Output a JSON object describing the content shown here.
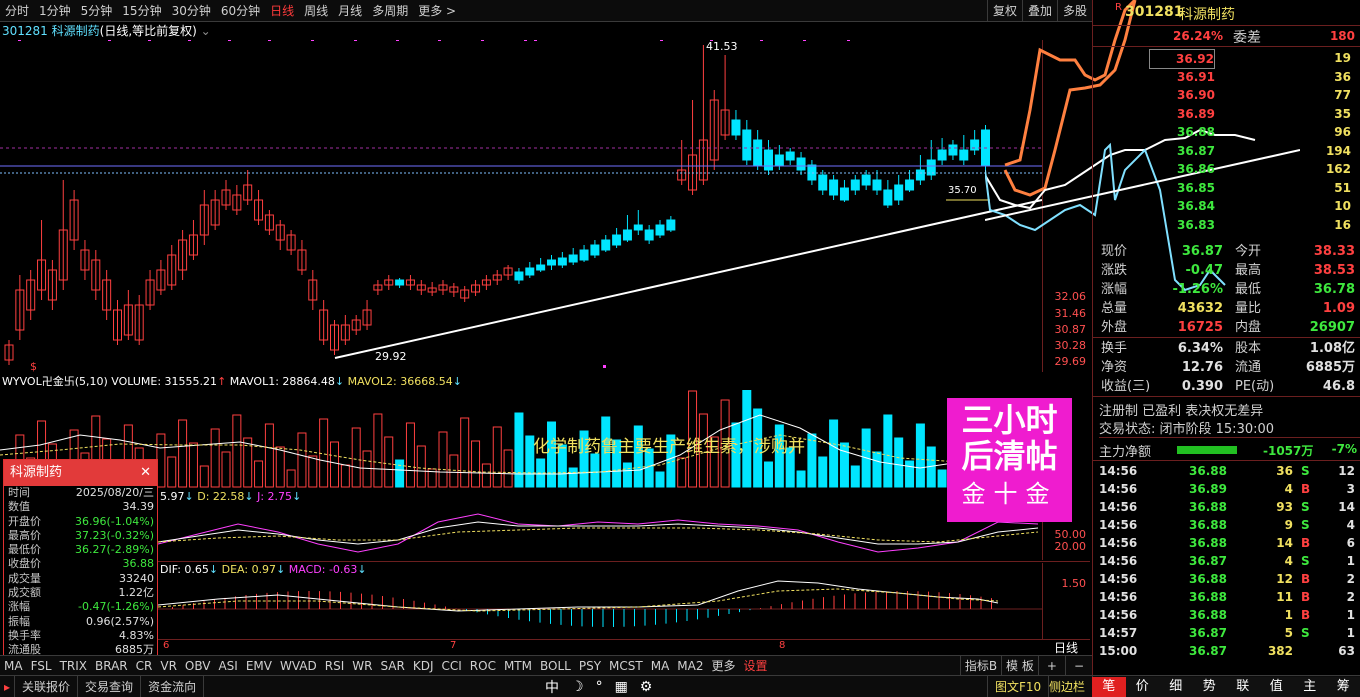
{
  "toolbar": {
    "periods": [
      "分时",
      "1分钟",
      "5分钟",
      "15分钟",
      "30分钟",
      "60分钟",
      "日线",
      "周线",
      "月线",
      "多周期",
      "更多 >"
    ],
    "active": "日线",
    "right_buttons": [
      "复权",
      "叠加",
      "多股"
    ]
  },
  "stock": {
    "code": "301281",
    "name": "科源制药",
    "chart_title": "(日线,等比前复权)"
  },
  "main_chart": {
    "high_label": "41.53",
    "low_label": "29.92",
    "mid_label": "35.70",
    "axis_labels": [
      "32.06",
      "31.46",
      "30.87",
      "30.28",
      "29.69"
    ]
  },
  "volume": {
    "name": "WYVOL卍金卐(5,10)",
    "volume": "VOLUME: 31555.21",
    "mavol1": "MAVOL1: 28864.48",
    "mavol2": "MAVOL2: 36668.54",
    "marquee": "化学制药鲁主要生产维生素，涉购并"
  },
  "kdj": {
    "k": "5.97",
    "d": "D: 22.58",
    "j": "J: 2.75",
    "ax1": "50.00",
    "ax2": "20.00"
  },
  "macd": {
    "dif": "DIF: 0.65",
    "dea": "DEA: 0.97",
    "macd": "MACD: -0.63",
    "ax1": "1.50"
  },
  "month_marks": [
    "6",
    "7",
    "8"
  ],
  "popup": {
    "title": "科源制药",
    "rows": [
      [
        "时间",
        "2025/08/20/三"
      ],
      [
        "数值",
        "34.39"
      ],
      [
        "开盘价",
        "36.96(-1.04%)"
      ],
      [
        "最高价",
        "37.23(-0.32%)"
      ],
      [
        "最低价",
        "36.27(-2.89%)"
      ],
      [
        "收盘价",
        "36.88"
      ],
      [
        "成交量",
        "33240"
      ],
      [
        "成交额",
        "1.22亿"
      ],
      [
        "涨幅",
        "-0.47(-1.26%)"
      ],
      [
        "振幅",
        "0.96(2.57%)"
      ],
      [
        "换手率",
        "4.83%"
      ],
      [
        "流通股",
        "6885万"
      ]
    ]
  },
  "indicator_tabs": [
    "MA",
    "FSL",
    "TRIX",
    "BRAR",
    "CR",
    "VR",
    "OBV",
    "ASI",
    "EMV",
    "WVAD",
    "RSI",
    "WR",
    "SAR",
    "KDJ",
    "CCI",
    "ROC",
    "MTM",
    "BOLL",
    "PSY",
    "MCST",
    "MA",
    "MA2",
    "更多",
    "设置"
  ],
  "indicator_right": [
    "指标B",
    "模 板",
    "+",
    "−"
  ],
  "day_line": "日线",
  "statusbar": {
    "left": [
      "关联报价",
      "交易查询",
      "资金流向"
    ],
    "center_icons": [
      "中",
      "☽",
      "°",
      "▦",
      "⚙"
    ],
    "right": [
      "图文F10",
      "侧边栏"
    ]
  },
  "rpanel": {
    "code": "301281",
    "name": "科源制药",
    "r_mark": "R",
    "weibi_pct": "26.24%",
    "weicha_label": "委差",
    "weicha_val": "180",
    "orderbook": [
      [
        "36.92",
        "19"
      ],
      [
        "36.91",
        "36"
      ],
      [
        "36.90",
        "77"
      ],
      [
        "36.89",
        "35"
      ],
      [
        "36.88",
        "96"
      ],
      [
        "36.87",
        "194"
      ],
      [
        "36.86",
        "162"
      ],
      [
        "36.85",
        "51"
      ],
      [
        "36.84",
        "10"
      ],
      [
        "36.83",
        "16"
      ]
    ],
    "quote_left": [
      [
        "现价",
        "36.87"
      ],
      [
        "涨跌",
        "-0.47"
      ],
      [
        "涨幅",
        "-1.26%"
      ],
      [
        "总量",
        "43632"
      ],
      [
        "外盘",
        "16725"
      ]
    ],
    "quote_right": [
      [
        "今开",
        "38.33"
      ],
      [
        "最高",
        "38.53"
      ],
      [
        "最低",
        "36.78"
      ],
      [
        "量比",
        "1.09"
      ],
      [
        "内盘",
        "26907"
      ]
    ],
    "stats_left": [
      [
        "换手",
        "6.34%"
      ],
      [
        "净资",
        "12.76"
      ],
      [
        "收益(三)",
        "0.390"
      ]
    ],
    "stats_right": [
      [
        "股本",
        "1.08亿"
      ],
      [
        "流通",
        "6885万"
      ],
      [
        "PE(动)",
        "46.8"
      ]
    ],
    "reg_line": "注册制 已盈利 表决权无差异",
    "trade_status": "交易状态: 闭市阶段 15:30:00",
    "main_flow_label": "主力净额",
    "main_flow_val": "-1057万",
    "main_flow_pct": "-7%",
    "ticks": [
      [
        "14:56",
        "36.88",
        "36",
        "S",
        "12"
      ],
      [
        "14:56",
        "36.89",
        "4",
        "B",
        "3"
      ],
      [
        "14:56",
        "36.88",
        "93",
        "S",
        "14"
      ],
      [
        "14:56",
        "36.88",
        "9",
        "S",
        "4"
      ],
      [
        "14:56",
        "36.88",
        "14",
        "B",
        "6"
      ],
      [
        "14:56",
        "36.87",
        "4",
        "S",
        "1"
      ],
      [
        "14:56",
        "36.88",
        "12",
        "B",
        "2"
      ],
      [
        "14:56",
        "36.88",
        "11",
        "B",
        "2"
      ],
      [
        "14:56",
        "36.88",
        "1",
        "B",
        "1"
      ],
      [
        "14:57",
        "36.87",
        "5",
        "S",
        "1"
      ],
      [
        "15:00",
        "36.87",
        "382",
        "",
        "63"
      ]
    ],
    "tabs": [
      "笔",
      "价",
      "细",
      "势",
      "联",
      "值",
      "主",
      "筹"
    ]
  },
  "promo": {
    "line1": "三小时",
    "line2": "后清帖",
    "line3": "金十金"
  }
}
